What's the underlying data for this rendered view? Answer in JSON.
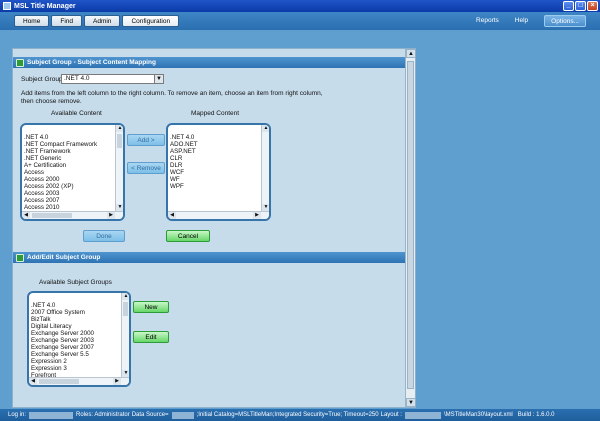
{
  "window": {
    "title": "MSL Title Manager"
  },
  "nav": {
    "tabs": [
      "Home",
      "Find",
      "Admin",
      "Configuration"
    ],
    "active_tab": "Configuration",
    "links": [
      "Reports",
      "Help"
    ],
    "options_label": "Options..."
  },
  "mapping": {
    "header": "Subject Group - Subject Content Mapping",
    "subject_group_label": "Subject Group",
    "subject_group_value": ".NET 4.0",
    "instructions_line1": "Add items from the left column to the right column. To remove an item, choose an item from right column,",
    "instructions_line2": "then choose remove.",
    "available_label": "Available Content",
    "mapped_label": "Mapped Content",
    "available_items": [
      ".NET 4.0",
      ".NET Compact Framework",
      ".NET Framework",
      ".NET Generic",
      "A+ Certification",
      "Access",
      "Access 2000",
      "Access 2002 (XP)",
      "Access 2003",
      "Access 2007",
      "Access 2010"
    ],
    "mapped_items": [
      ".NET 4.0",
      "ADO.NET",
      "ASP.NET",
      "CLR",
      "DLR",
      "WCF",
      "WF",
      "WPF"
    ],
    "add_label": "Add >",
    "remove_label": "< Remove",
    "done_label": "Done",
    "cancel_label": "Cancel"
  },
  "edit": {
    "header": "Add/Edit Subject Group",
    "available_label": "Available Subject Groups",
    "items": [
      ".NET 4.0",
      "2007 Office System",
      "BizTalk",
      "Digital Literacy",
      "Exchange Server 2000",
      "Exchange Server 2003",
      "Exchange Server 2007",
      "Exchange Server 5.5",
      "Expression 2",
      "Expression 3",
      "Forefront"
    ],
    "new_label": "New",
    "edit_label": "Edit"
  },
  "status": {
    "login_label": "Log in:",
    "roles": "Roles: Administrator",
    "data_source_label": "Data Source=",
    "catalog": ";Initial Catalog=MSLTitleMan;Integrated Security=True; Timeout=250",
    "layout_label": "Layout :",
    "layout_file": "\\MSTitleMan30\\layout.xml",
    "build": "Build : 1.6.0.0"
  }
}
